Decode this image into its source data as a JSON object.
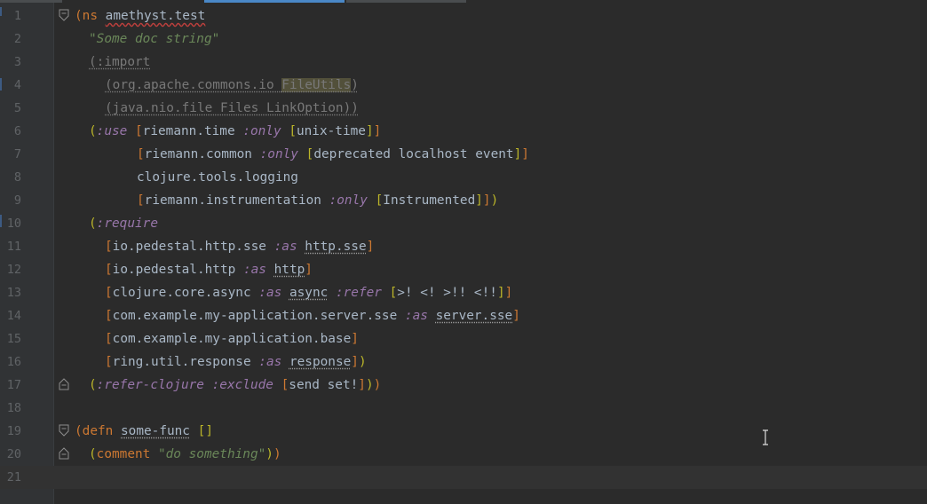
{
  "lines": [
    {
      "n": "1",
      "tokens": [
        {
          "t": "(",
          "c": "p1"
        },
        {
          "t": "ns ",
          "c": "p1"
        },
        {
          "t": "amethyst.test",
          "c": "sym ns-wavy"
        }
      ]
    },
    {
      "n": "2",
      "indent": "i1",
      "tokens": [
        {
          "t": "\"Some doc string\"",
          "c": "str"
        }
      ]
    },
    {
      "n": "3",
      "indent": "i1",
      "tokens": [
        {
          "t": "(",
          "c": "dim"
        },
        {
          "t": ":import",
          "c": "dim"
        }
      ]
    },
    {
      "n": "4",
      "indent": "i2",
      "tokens": [
        {
          "t": "(org.apache.commons.io ",
          "c": "dim"
        },
        {
          "t": "FileUtils",
          "c": "dim hl"
        },
        {
          "t": ")",
          "c": "dim"
        }
      ]
    },
    {
      "n": "5",
      "indent": "i2",
      "tokens": [
        {
          "t": "(java.nio.file Files LinkOption))",
          "c": "dim"
        }
      ]
    },
    {
      "n": "6",
      "indent": "i1",
      "tokens": [
        {
          "t": "(",
          "c": "p2"
        },
        {
          "t": ":use",
          "c": "kw"
        },
        {
          "t": " ",
          "c": "sym"
        },
        {
          "t": "[",
          "c": "p1"
        },
        {
          "t": "riemann.time ",
          "c": "sym"
        },
        {
          "t": ":only",
          "c": "kw"
        },
        {
          "t": " ",
          "c": "sym"
        },
        {
          "t": "[",
          "c": "p2"
        },
        {
          "t": "unix-time",
          "c": "sym"
        },
        {
          "t": "]",
          "c": "p2"
        },
        {
          "t": "]",
          "c": "p1"
        }
      ]
    },
    {
      "n": "7",
      "indent": "i3",
      "tokens": [
        {
          "t": "[",
          "c": "p1"
        },
        {
          "t": "riemann.common ",
          "c": "sym"
        },
        {
          "t": ":only",
          "c": "kw"
        },
        {
          "t": " ",
          "c": "sym"
        },
        {
          "t": "[",
          "c": "p2"
        },
        {
          "t": "deprecated localhost event",
          "c": "sym"
        },
        {
          "t": "]",
          "c": "p2"
        },
        {
          "t": "]",
          "c": "p1"
        }
      ]
    },
    {
      "n": "8",
      "indent": "i3",
      "tokens": [
        {
          "t": "clojure.tools.logging",
          "c": "sym"
        }
      ]
    },
    {
      "n": "9",
      "indent": "i3",
      "tokens": [
        {
          "t": "[",
          "c": "p1"
        },
        {
          "t": "riemann.instrumentation ",
          "c": "sym"
        },
        {
          "t": ":only",
          "c": "kw"
        },
        {
          "t": " ",
          "c": "sym"
        },
        {
          "t": "[",
          "c": "p2"
        },
        {
          "t": "Instrumented",
          "c": "sym"
        },
        {
          "t": "]",
          "c": "p2"
        },
        {
          "t": "]",
          "c": "p1"
        },
        {
          "t": ")",
          "c": "p2"
        }
      ]
    },
    {
      "n": "10",
      "indent": "i1",
      "tokens": [
        {
          "t": "(",
          "c": "p2"
        },
        {
          "t": ":require",
          "c": "kw"
        }
      ]
    },
    {
      "n": "11",
      "indent": "i2",
      "tokens": [
        {
          "t": "[",
          "c": "p1"
        },
        {
          "t": "io.pedestal.http.sse ",
          "c": "sym"
        },
        {
          "t": ":as",
          "c": "kw"
        },
        {
          "t": " ",
          "c": "sym"
        },
        {
          "t": "http.sse",
          "c": "sym unused"
        },
        {
          "t": "]",
          "c": "p1"
        }
      ]
    },
    {
      "n": "12",
      "indent": "i2",
      "tokens": [
        {
          "t": "[",
          "c": "p1"
        },
        {
          "t": "io.pedestal.http ",
          "c": "sym"
        },
        {
          "t": ":as",
          "c": "kw"
        },
        {
          "t": " ",
          "c": "sym"
        },
        {
          "t": "http",
          "c": "sym unused"
        },
        {
          "t": "]",
          "c": "p1"
        }
      ]
    },
    {
      "n": "13",
      "indent": "i2",
      "tokens": [
        {
          "t": "[",
          "c": "p1"
        },
        {
          "t": "clojure.core.async ",
          "c": "sym"
        },
        {
          "t": ":as",
          "c": "kw"
        },
        {
          "t": " ",
          "c": "sym"
        },
        {
          "t": "async",
          "c": "sym unused"
        },
        {
          "t": " ",
          "c": "sym"
        },
        {
          "t": ":refer",
          "c": "kw"
        },
        {
          "t": " ",
          "c": "sym"
        },
        {
          "t": "[",
          "c": "p2"
        },
        {
          "t": ">! <! >!! <!!",
          "c": "sym"
        },
        {
          "t": "]",
          "c": "p2"
        },
        {
          "t": "]",
          "c": "p1"
        }
      ]
    },
    {
      "n": "14",
      "indent": "i2",
      "tokens": [
        {
          "t": "[",
          "c": "p1"
        },
        {
          "t": "com.example.my-application.server.sse ",
          "c": "sym"
        },
        {
          "t": ":as",
          "c": "kw"
        },
        {
          "t": " ",
          "c": "sym"
        },
        {
          "t": "server.sse",
          "c": "sym unused"
        },
        {
          "t": "]",
          "c": "p1"
        }
      ]
    },
    {
      "n": "15",
      "indent": "i2",
      "tokens": [
        {
          "t": "[",
          "c": "p1"
        },
        {
          "t": "com.example.my-application.base",
          "c": "sym"
        },
        {
          "t": "]",
          "c": "p1"
        }
      ]
    },
    {
      "n": "16",
      "indent": "i2",
      "tokens": [
        {
          "t": "[",
          "c": "p1"
        },
        {
          "t": "ring.util.response ",
          "c": "sym"
        },
        {
          "t": ":as",
          "c": "kw"
        },
        {
          "t": " ",
          "c": "sym"
        },
        {
          "t": "response",
          "c": "sym unused"
        },
        {
          "t": "]",
          "c": "p1"
        },
        {
          "t": ")",
          "c": "p2"
        }
      ]
    },
    {
      "n": "17",
      "indent": "i1",
      "tokens": [
        {
          "t": "(",
          "c": "p2"
        },
        {
          "t": ":refer-clojure",
          "c": "kw"
        },
        {
          "t": " ",
          "c": "sym"
        },
        {
          "t": ":exclude",
          "c": "kw"
        },
        {
          "t": " ",
          "c": "sym"
        },
        {
          "t": "[",
          "c": "p1"
        },
        {
          "t": "send set!",
          "c": "sym"
        },
        {
          "t": "]",
          "c": "p1"
        },
        {
          "t": ")",
          "c": "p2"
        },
        {
          "t": ")",
          "c": "p1"
        }
      ]
    },
    {
      "n": "18",
      "tokens": []
    },
    {
      "n": "19",
      "tokens": [
        {
          "t": "(",
          "c": "p1"
        },
        {
          "t": "defn ",
          "c": "p1"
        },
        {
          "t": "some-func",
          "c": "sym unused"
        },
        {
          "t": " ",
          "c": "sym"
        },
        {
          "t": "[]",
          "c": "p2"
        }
      ]
    },
    {
      "n": "20",
      "indent": "i1",
      "tokens": [
        {
          "t": "(",
          "c": "p2"
        },
        {
          "t": "comment ",
          "c": "p1"
        },
        {
          "t": "\"do something\"",
          "c": "str"
        },
        {
          "t": ")",
          "c": "p2"
        },
        {
          "t": ")",
          "c": "p1"
        }
      ]
    },
    {
      "n": "21",
      "current": true,
      "tokens": []
    }
  ],
  "folds": {
    "1": "open",
    "17": "close",
    "19": "open",
    "20": "close"
  },
  "colors": {
    "background": "#2b2b2b",
    "gutter": "#313335",
    "bracket1": "#cc7832",
    "bracket2": "#bbb529",
    "keyword": "#9876aa",
    "string": "#6a8759"
  }
}
